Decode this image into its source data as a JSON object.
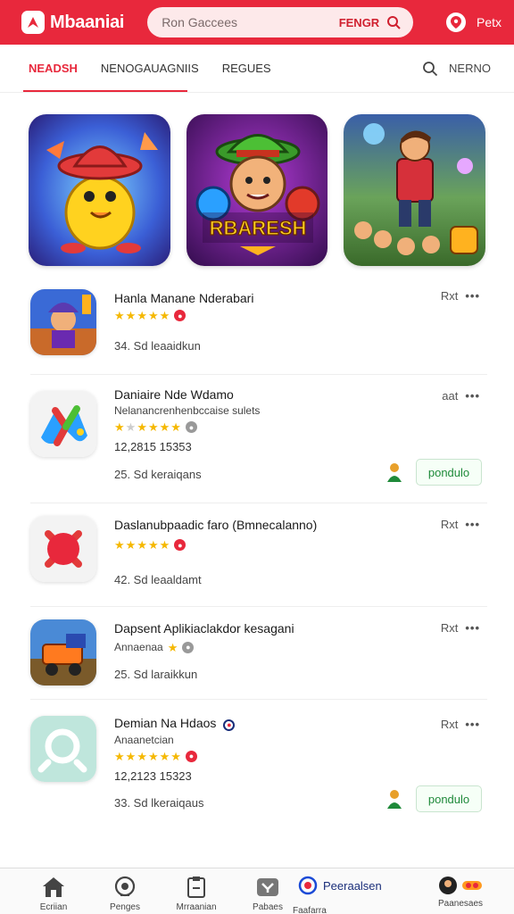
{
  "header": {
    "brand": "Mbaaniai",
    "search_placeholder": "Ron Gaccees",
    "search_right_label": "FENGR",
    "right_label": "Petx"
  },
  "tabs": {
    "items": [
      "NEADSH",
      "NENOGAUAGNIIS",
      "REGUES"
    ],
    "active_index": 0,
    "right_label": "NERNO"
  },
  "featured": {
    "card3_title": "RBARESH"
  },
  "apps": [
    {
      "name": "Hanla Manane Nderabari",
      "price": "Rxt",
      "downloads": "34.  Sd  leaaidkun",
      "rating": 5
    },
    {
      "name": "Daniaire Nde Wdamo",
      "subtitle": "Nelanancrenhenbccaise sulets",
      "price": "aat",
      "meta": "12,2815  15353",
      "downloads": "25.  Sd  keraiqans",
      "action": "pondulo",
      "rating": 4
    },
    {
      "name": "Daslanubpaadic faro (Bmnecalanno)",
      "price": "Rxt",
      "downloads": "42.  Sd  leaaldamt",
      "rating": 5
    },
    {
      "name": "Dapsent Aplikiaclakdor kesagani",
      "subtitle": "Annaenaa",
      "price": "Rxt",
      "downloads": "25.  Sd  laraikkun",
      "rating": 1
    },
    {
      "name": "Demian Na Hdaos",
      "subtitle": "Anaanetcian",
      "price": "Rxt",
      "meta": "12,2123  15323",
      "downloads": "33.  Sd  lkeraiqaus",
      "action": "pondulo",
      "rating": 5
    }
  ],
  "bottom_nav": {
    "items": [
      "Ecriian",
      "Penges",
      "Mrraanian",
      "Pabaes",
      "Faafarra",
      "Paanesaes"
    ],
    "special_label": "Peeraalsen"
  },
  "colors": {
    "accent": "#e8283c",
    "star": "#f5b800",
    "action_text": "#1f8a3a"
  }
}
